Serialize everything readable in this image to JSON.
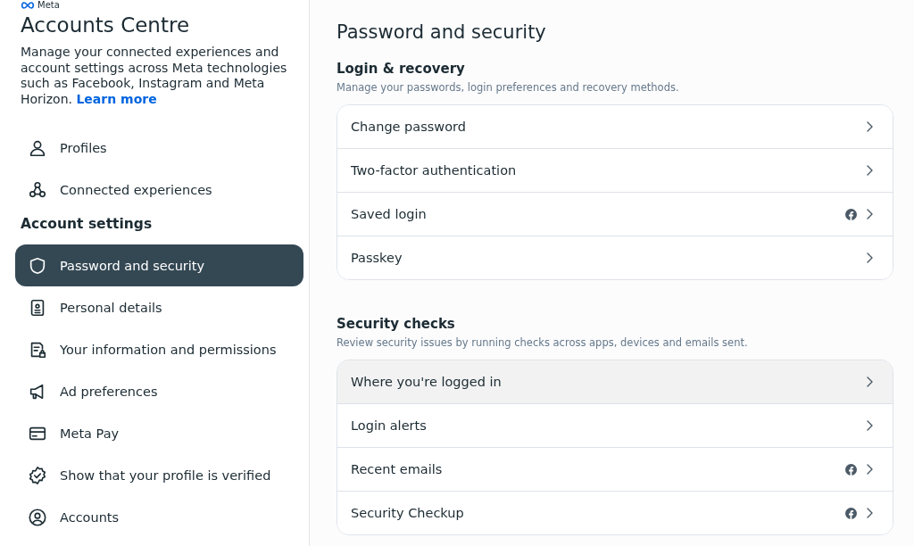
{
  "logo": {
    "text": "Meta"
  },
  "sidebar": {
    "title": "Accounts Centre",
    "description": "Manage your connected experiences and account settings across Meta technologies such as Facebook, Instagram and Meta Horizon.",
    "link": "Learn more",
    "top_items": [
      {
        "label": "Profiles",
        "selected": false
      },
      {
        "label": "Connected experiences",
        "selected": false
      }
    ],
    "section_title": "Account settings",
    "items": [
      {
        "label": "Password and security",
        "selected": true
      },
      {
        "label": "Personal details",
        "selected": false
      },
      {
        "label": "Your information and permissions",
        "selected": false
      },
      {
        "label": "Ad preferences",
        "selected": false
      },
      {
        "label": "Meta Pay",
        "selected": false
      },
      {
        "label": "Show that your profile is verified",
        "selected": false
      },
      {
        "label": "Accounts",
        "selected": false
      }
    ]
  },
  "main": {
    "title": "Password and security",
    "sections": [
      {
        "title": "Login & recovery",
        "description": "Manage your passwords, login preferences and recovery methods.",
        "rows": [
          {
            "label": "Change password",
            "facebook": false,
            "hovered": false
          },
          {
            "label": "Two-factor authentication",
            "facebook": false,
            "hovered": false
          },
          {
            "label": "Saved login",
            "facebook": true,
            "hovered": false
          },
          {
            "label": "Passkey",
            "facebook": false,
            "hovered": false
          }
        ]
      },
      {
        "title": "Security checks",
        "description": "Review security issues by running checks across apps, devices and emails sent.",
        "rows": [
          {
            "label": "Where you're logged in",
            "facebook": false,
            "hovered": true
          },
          {
            "label": "Login alerts",
            "facebook": false,
            "hovered": false
          },
          {
            "label": "Recent emails",
            "facebook": true,
            "hovered": false
          },
          {
            "label": "Security Checkup",
            "facebook": true,
            "hovered": false
          }
        ]
      }
    ]
  }
}
